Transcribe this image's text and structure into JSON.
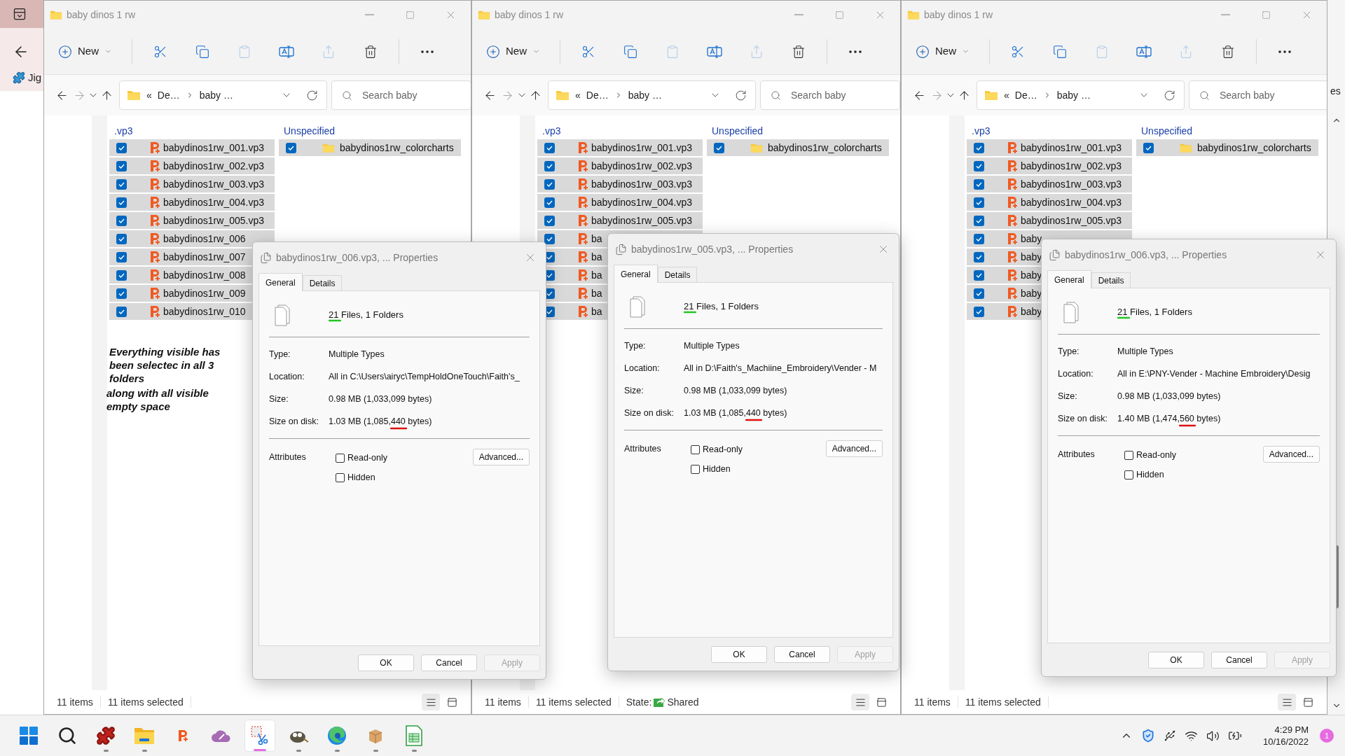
{
  "background_window": {
    "bookmark": "Jig",
    "edge_text": "es"
  },
  "windows": [
    {
      "title": "baby dinos 1 rw",
      "new_label": "New",
      "address": {
        "prefix": "«",
        "segments": [
          "De…",
          "baby …"
        ]
      },
      "search": {
        "placeholder": "Search baby"
      },
      "groups": [
        {
          "header": ".vp3",
          "items": [
            {
              "name": "babydinos1rw_001.vp3",
              "checked": true
            },
            {
              "name": "babydinos1rw_002.vp3",
              "checked": true
            },
            {
              "name": "babydinos1rw_003.vp3",
              "checked": true
            },
            {
              "name": "babydinos1rw_004.vp3",
              "checked": true
            },
            {
              "name": "babydinos1rw_005.vp3",
              "checked": true
            },
            {
              "name": "babydinos1rw_006",
              "checked": true
            },
            {
              "name": "babydinos1rw_007",
              "checked": true
            },
            {
              "name": "babydinos1rw_008",
              "checked": true
            },
            {
              "name": "babydinos1rw_009",
              "checked": true
            },
            {
              "name": "babydinos1rw_010",
              "checked": true
            }
          ]
        },
        {
          "header": "Unspecified",
          "items": [
            {
              "name": "babydinos1rw_colorcharts",
              "checked": true
            }
          ]
        }
      ],
      "notes": [
        "Everything visible has been selectec in all 3 folders",
        "along with all visible empty space"
      ],
      "status": {
        "count": "11 items",
        "selected": "11 items selected"
      },
      "dialog": {
        "title": "babydinos1rw_006.vp3, ... Properties",
        "tabs": [
          {
            "label": "General",
            "selected": true
          },
          {
            "label": "Details",
            "selected": false
          }
        ],
        "summary": "21 Files, 1 Folders",
        "properties": [
          {
            "label": "Type:",
            "value": "Multiple Types"
          },
          {
            "label": "Location:",
            "value": "All in C:\\Users\\airyc\\TempHoldOneTouch\\Faith's_"
          },
          {
            "label": "Size:",
            "value": "0.98 MB (1,033,099 bytes)"
          },
          {
            "label": "Size on disk:",
            "value": "1.03 MB (1,085,440 bytes)"
          }
        ],
        "attributes_label": "Attributes",
        "attributes": [
          {
            "label": "Read-only",
            "checked": false
          },
          {
            "label": "Hidden",
            "checked": false
          }
        ],
        "advanced": "Advanced...",
        "buttons": [
          {
            "label": "OK",
            "disabled": false
          },
          {
            "label": "Cancel",
            "disabled": false
          },
          {
            "label": "Apply",
            "disabled": true
          }
        ]
      }
    },
    {
      "title": "baby dinos 1 rw",
      "new_label": "New",
      "address": {
        "prefix": "«",
        "segments": [
          "De…",
          "baby …"
        ]
      },
      "search": {
        "placeholder": "Search baby"
      },
      "groups": [
        {
          "header": ".vp3",
          "items": [
            {
              "name": "babydinos1rw_001.vp3",
              "checked": true
            },
            {
              "name": "babydinos1rw_002.vp3",
              "checked": true
            },
            {
              "name": "babydinos1rw_003.vp3",
              "checked": true
            },
            {
              "name": "babydinos1rw_004.vp3",
              "checked": true
            },
            {
              "name": "babydinos1rw_005.vp3",
              "checked": true
            },
            {
              "name": "ba",
              "checked": true
            },
            {
              "name": "ba",
              "checked": true
            },
            {
              "name": "ba",
              "checked": true
            },
            {
              "name": "ba",
              "checked": true
            },
            {
              "name": "ba",
              "checked": true
            }
          ]
        },
        {
          "header": "Unspecified",
          "items": [
            {
              "name": "babydinos1rw_colorcharts",
              "checked": true
            }
          ]
        }
      ],
      "status": {
        "count": "11 items",
        "selected": "11 items selected",
        "state_label": "State:",
        "state_value": "Shared"
      },
      "dialog": {
        "title": "babydinos1rw_005.vp3, ... Properties",
        "tabs": [
          {
            "label": "General",
            "selected": true
          },
          {
            "label": "Details",
            "selected": false
          }
        ],
        "summary": "21 Files, 1 Folders",
        "properties": [
          {
            "label": "Type:",
            "value": "Multiple Types"
          },
          {
            "label": "Location:",
            "value": "All in D:\\Faith's_Machiine_Embroidery\\Vender - M"
          },
          {
            "label": "Size:",
            "value": "0.98 MB (1,033,099 bytes)"
          },
          {
            "label": "Size on disk:",
            "value": "1.03 MB (1,085,440 bytes)"
          }
        ],
        "attributes_label": "Attributes",
        "attributes": [
          {
            "label": "Read-only",
            "checked": false
          },
          {
            "label": "Hidden",
            "checked": false
          }
        ],
        "advanced": "Advanced...",
        "buttons": [
          {
            "label": "OK",
            "disabled": false
          },
          {
            "label": "Cancel",
            "disabled": false
          },
          {
            "label": "Apply",
            "disabled": true
          }
        ]
      }
    },
    {
      "title": "baby dinos 1 rw",
      "new_label": "New",
      "address": {
        "prefix": "«",
        "segments": [
          "De…",
          "baby …"
        ]
      },
      "search": {
        "placeholder": "Search baby"
      },
      "groups": [
        {
          "header": ".vp3",
          "items": [
            {
              "name": "babydinos1rw_001.vp3",
              "checked": true
            },
            {
              "name": "babydinos1rw_002.vp3",
              "checked": true
            },
            {
              "name": "babydinos1rw_003.vp3",
              "checked": true
            },
            {
              "name": "babydinos1rw_004.vp3",
              "checked": true
            },
            {
              "name": "babydinos1rw_005.vp3",
              "checked": true
            },
            {
              "name": "baby",
              "checked": true
            },
            {
              "name": "baby",
              "checked": true
            },
            {
              "name": "baby",
              "checked": true
            },
            {
              "name": "baby",
              "checked": true
            },
            {
              "name": "baby",
              "checked": true
            }
          ]
        },
        {
          "header": "Unspecified",
          "items": [
            {
              "name": "babydinos1rw_colorcharts",
              "checked": true
            }
          ]
        }
      ],
      "status": {
        "count": "11 items",
        "selected": "11 items selected"
      },
      "dialog": {
        "title": "babydinos1rw_006.vp3, ... Properties",
        "tabs": [
          {
            "label": "General",
            "selected": true
          },
          {
            "label": "Details",
            "selected": false
          }
        ],
        "summary": "21 Files, 1 Folders",
        "properties": [
          {
            "label": "Type:",
            "value": "Multiple Types"
          },
          {
            "label": "Location:",
            "value": "All in E:\\PNY-Vender - Machine Embroidery\\Desig"
          },
          {
            "label": "Size:",
            "value": "0.98 MB (1,033,099 bytes)"
          },
          {
            "label": "Size on disk:",
            "value": "1.40 MB (1,474,560 bytes)"
          }
        ],
        "attributes_label": "Attributes",
        "attributes": [
          {
            "label": "Read-only",
            "checked": false
          },
          {
            "label": "Hidden",
            "checked": false
          }
        ],
        "advanced": "Advanced...",
        "buttons": [
          {
            "label": "OK",
            "disabled": false
          },
          {
            "label": "Cancel",
            "disabled": false
          },
          {
            "label": "Apply",
            "disabled": true
          }
        ]
      }
    }
  ],
  "taskbar": {
    "apps": [
      {
        "kind": "start",
        "running": false,
        "selected": false
      },
      {
        "kind": "search",
        "running": false,
        "selected": false
      },
      {
        "kind": "puzzle",
        "running": true,
        "selected": false
      },
      {
        "kind": "explorer",
        "running": true,
        "selected": false
      },
      {
        "kind": "pdf",
        "running": false,
        "selected": false
      },
      {
        "kind": "cloud",
        "running": false,
        "selected": false
      },
      {
        "kind": "snip",
        "running": true,
        "selected": true
      },
      {
        "kind": "gimp",
        "running": true,
        "selected": false
      },
      {
        "kind": "edge",
        "running": true,
        "selected": false
      },
      {
        "kind": "package",
        "running": true,
        "selected": false
      },
      {
        "kind": "sheet",
        "running": true,
        "selected": false
      }
    ],
    "clock": {
      "time": "4:29 PM",
      "date": "10/16/2022"
    },
    "notifications": "1"
  }
}
